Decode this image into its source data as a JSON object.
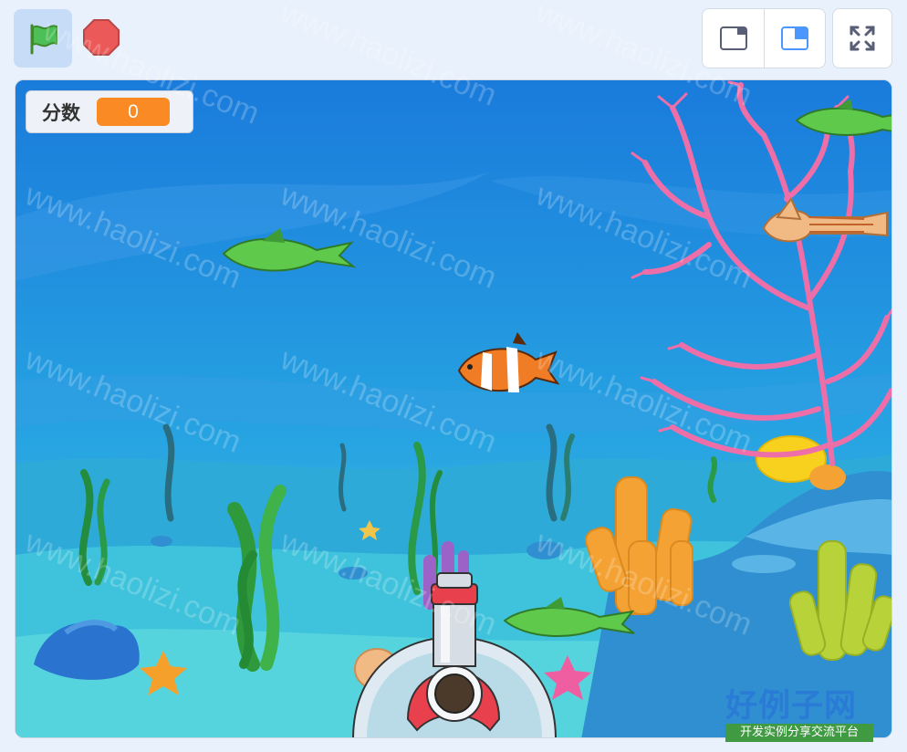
{
  "toolbar": {
    "green_flag_icon": "green-flag-icon",
    "stop_icon": "stop-icon",
    "small_stage_icon": "small-stage-icon",
    "large_stage_icon": "large-stage-icon",
    "fullscreen_icon": "fullscreen-icon",
    "colors": {
      "flag_bg": "#c7dcf7",
      "stop": "#ec5959",
      "selected_view": "#4c97ff"
    }
  },
  "monitor": {
    "label": "分数",
    "value": "0",
    "value_color": "#f98a24"
  },
  "watermark": {
    "text": "www.haolizi.com"
  },
  "logo": {
    "main": "好例子网",
    "sub": "开发实例分享交流平台"
  }
}
